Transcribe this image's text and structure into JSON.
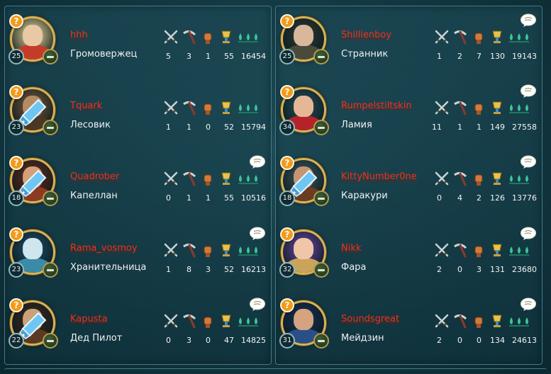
{
  "colors": {
    "name_red": "#ff2b12",
    "frame_gold": "#d6b35a",
    "help_orange": "#f39a1c"
  },
  "icons": {
    "help": "question-mark",
    "swords": "crossed-swords-icon",
    "pickaxe": "pickaxe-icon",
    "fist": "fist-icon",
    "trophy": "trophy-icon",
    "drops": "drops-icon",
    "chat": "speech-bubble-icon",
    "kick": "minus-icon",
    "weapon_overlay": "sword-icon"
  },
  "help_glyph": "?",
  "players": [
    {
      "name": "hhh",
      "title": "Громовержец",
      "level": "25",
      "stats": [
        "5",
        "3",
        "1",
        "55",
        "16454"
      ],
      "chat": false,
      "weapon": false,
      "portrait": [
        "#e9c9a5",
        "#c53b2a",
        "#f5e29a"
      ]
    },
    {
      "name": "Tquark",
      "title": "Лесовик",
      "level": "23",
      "stats": [
        "1",
        "1",
        "0",
        "52",
        "15794"
      ],
      "chat": false,
      "weapon": true,
      "portrait": [
        "#b58b64",
        "#4a3826",
        "#7b5a3a"
      ]
    },
    {
      "name": "Quadrober",
      "title": "Капеллан",
      "level": "18",
      "stats": [
        "0",
        "1",
        "1",
        "55",
        "10516"
      ],
      "chat": true,
      "weapon": true,
      "portrait": [
        "#d4a07a",
        "#8c3b22",
        "#6a2d1a"
      ]
    },
    {
      "name": "Rama_vosmoy",
      "title": "Хранительница",
      "level": "23",
      "stats": [
        "1",
        "8",
        "3",
        "52",
        "16213"
      ],
      "chat": true,
      "weapon": false,
      "portrait": [
        "#cfe6ef",
        "#3b8aa8",
        "#1f5069"
      ]
    },
    {
      "name": "Kapusta",
      "title": "Дед Пилот",
      "level": "22",
      "stats": [
        "0",
        "3",
        "0",
        "47",
        "14825"
      ],
      "chat": true,
      "weapon": true,
      "portrait": [
        "#caa27a",
        "#5b3a24",
        "#3e2a1c"
      ]
    },
    {
      "name": "Shillienboy",
      "title": "Странник",
      "level": "25",
      "stats": [
        "1",
        "2",
        "7",
        "130",
        "19143"
      ],
      "chat": true,
      "weapon": false,
      "portrait": [
        "#d8b79a",
        "#4a4a3a",
        "#2f3b33"
      ]
    },
    {
      "name": "Rumpelstiltskin",
      "title": "Ламия",
      "level": "34",
      "stats": [
        "11",
        "1",
        "1",
        "149",
        "27558"
      ],
      "chat": true,
      "weapon": false,
      "portrait": [
        "#e5b796",
        "#b5232a",
        "#24505a"
      ]
    },
    {
      "name": "KittyNumber0ne",
      "title": "Каракури",
      "level": "18",
      "stats": [
        "0",
        "4",
        "2",
        "126",
        "13776"
      ],
      "chat": true,
      "weapon": true,
      "portrait": [
        "#c69674",
        "#6a3c22",
        "#3c5a62"
      ]
    },
    {
      "name": "Nikk",
      "title": "Фара",
      "level": "32",
      "stats": [
        "2",
        "0",
        "3",
        "131",
        "23680"
      ],
      "chat": true,
      "weapon": false,
      "portrait": [
        "#f0c6a8",
        "#c9a45a",
        "#6a48a8"
      ]
    },
    {
      "name": "Soundsgreat",
      "title": "Мейдзин",
      "level": "31",
      "stats": [
        "2",
        "0",
        "0",
        "134",
        "24613"
      ],
      "chat": true,
      "weapon": false,
      "portrait": [
        "#d5a37f",
        "#2a4f88",
        "#16305a"
      ]
    }
  ]
}
